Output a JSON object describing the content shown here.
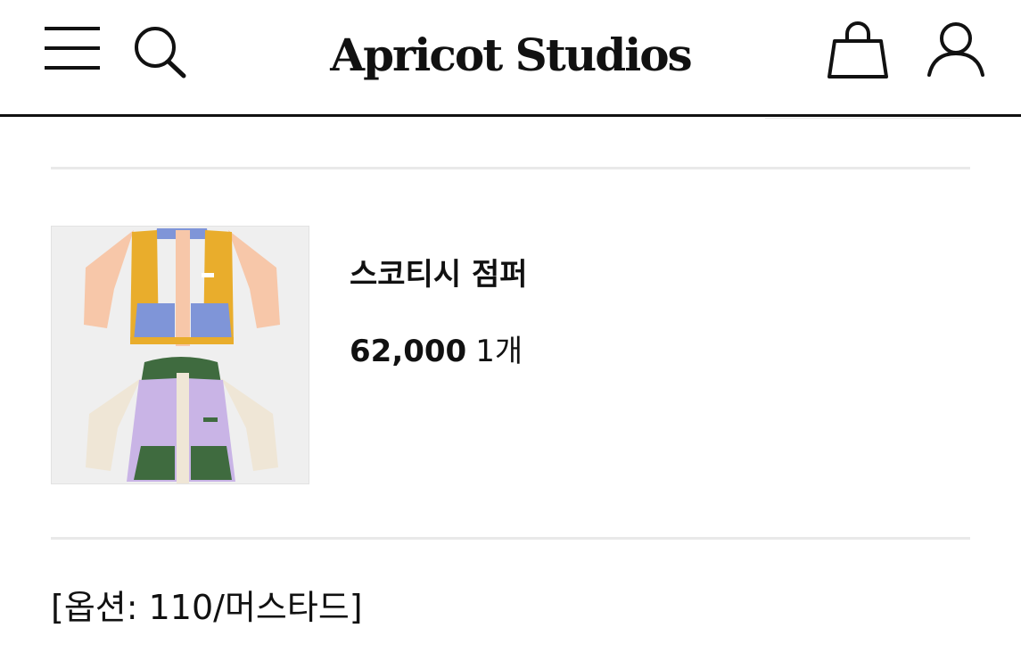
{
  "header": {
    "brand": "Apricot Studios",
    "icons": {
      "menu": "menu-icon",
      "search": "search-icon",
      "cart": "shopping-bag-icon",
      "account": "user-icon"
    }
  },
  "product": {
    "image_icon": "product-jackets-image",
    "name": "스코티시 점퍼",
    "price": "62,000",
    "quantity": "1개",
    "option": "[옵션: 110/머스타드]"
  },
  "colors": {
    "text": "#111111",
    "divider": "#e9e9e9",
    "thumb_bg": "#efefef"
  }
}
